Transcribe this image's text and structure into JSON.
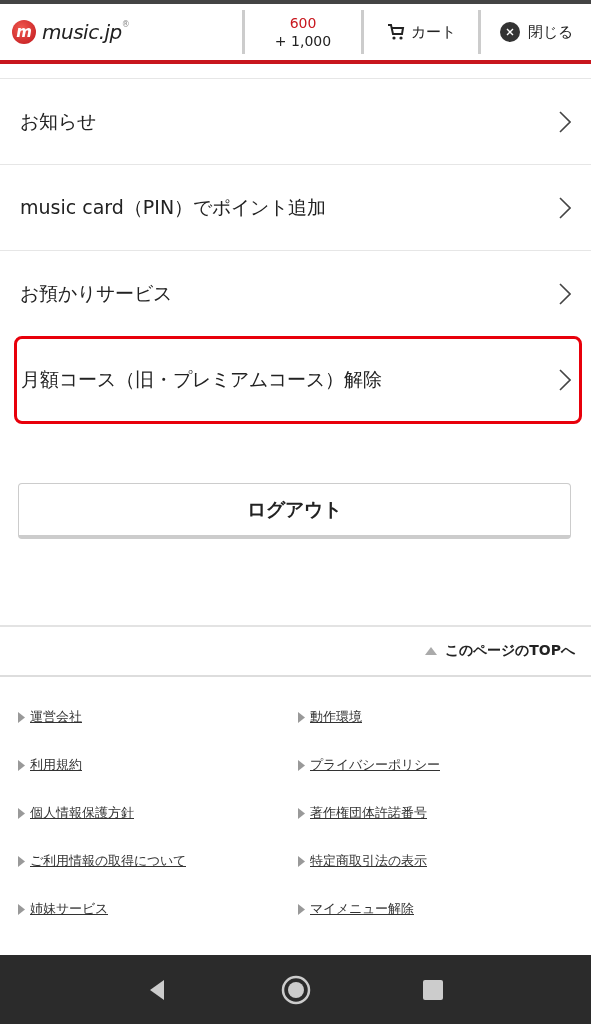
{
  "header": {
    "logo": {
      "mark": "m",
      "text": "music.jp",
      "registered": "®"
    },
    "points": {
      "balance": "600",
      "bonus": "+ 1,000"
    },
    "cart": {
      "label": "カート"
    },
    "close": {
      "label": "閉じる"
    }
  },
  "menu": [
    {
      "label": "お知らせ",
      "highlighted": false
    },
    {
      "label": "music card（PIN）でポイント追加",
      "highlighted": false
    },
    {
      "label": "お預かりサービス",
      "highlighted": false
    },
    {
      "label": "月額コース（旧・プレミアムコース）解除",
      "highlighted": true
    }
  ],
  "logout": {
    "label": "ログアウト"
  },
  "page_top": {
    "label": "このページのTOPへ"
  },
  "footer_links": [
    "運営会社",
    "動作環境",
    "利用規約",
    "プライバシーポリシー",
    "個人情報保護方針",
    "著作権団体許諾番号",
    "ご利用情報の取得について",
    "特定商取引法の表示",
    "姉妹サービス",
    "マイメニュー解除"
  ]
}
